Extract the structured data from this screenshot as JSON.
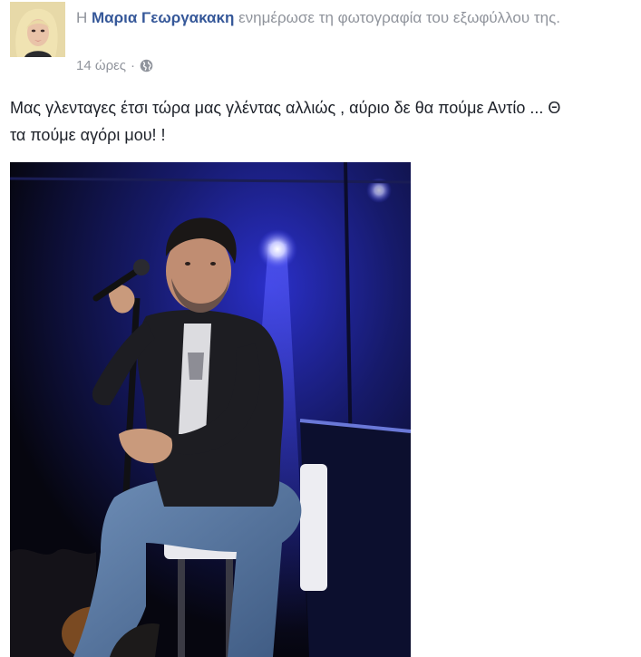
{
  "post": {
    "header": {
      "prefix": "Η",
      "author": "Μαρια Γεωργακακη",
      "action": "ενημέρωσε τη φωτογραφία του εξωφύλλου της."
    },
    "meta": {
      "timestamp": "14 ώρες",
      "separator": "·",
      "audience_icon": "globe-icon"
    },
    "message": {
      "line1": "Μας γλενταγες έτσι τώρα μας γλέντας αλλιώς , αύριο δε θα πούμε Αντίο ... Θ",
      "line2": "τα πούμε αγόρι μου! !"
    },
    "photo": {
      "subject": "singer-on-stage-photo"
    }
  },
  "colors": {
    "author_link": "#365899",
    "meta_text": "#90949c",
    "body_text": "#1d2129",
    "stage_background": "#0a0b18",
    "stage_light": "#3a3ff0"
  }
}
